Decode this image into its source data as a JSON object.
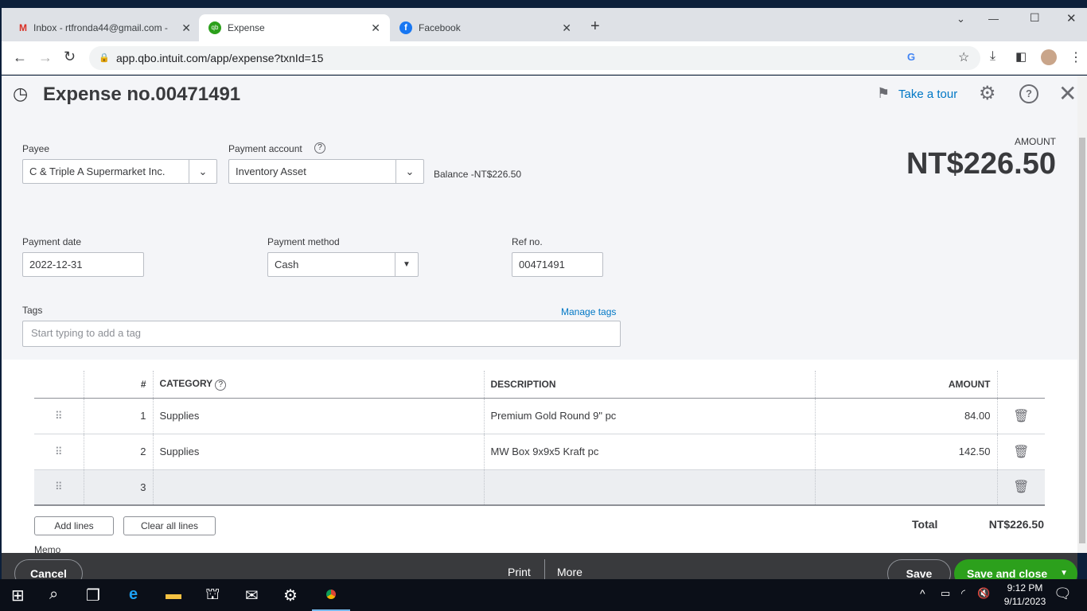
{
  "browser": {
    "tabs": [
      {
        "label": "Inbox - rtfronda44@gmail.com -"
      },
      {
        "label": "Expense"
      },
      {
        "label": "Facebook"
      }
    ],
    "url": "app.qbo.intuit.com/app/expense?txnId=15"
  },
  "header": {
    "title": "Expense no.00471491",
    "tour": "Take a tour"
  },
  "form": {
    "payee_label": "Payee",
    "payee": "C & Triple A Supermarket Inc.",
    "account_label": "Payment account",
    "account": "Inventory Asset",
    "balance": "Balance -NT$226.50",
    "amount_label": "AMOUNT",
    "amount": "NT$226.50",
    "date_label": "Payment date",
    "date": "2022-12-31",
    "method_label": "Payment method",
    "method": "Cash",
    "ref_label": "Ref no.",
    "ref": "00471491",
    "tags_label": "Tags",
    "manage_tags": "Manage tags",
    "tags_placeholder": "Start typing to add a tag"
  },
  "table": {
    "headers": [
      "#",
      "CATEGORY",
      "DESCRIPTION",
      "AMOUNT"
    ],
    "rows": [
      {
        "n": "1",
        "category": "Supplies",
        "description": "Premium Gold Round 9\" pc",
        "amount": "84.00"
      },
      {
        "n": "2",
        "category": "Supplies",
        "description": "MW Box 9x9x5 Kraft pc",
        "amount": "142.50"
      },
      {
        "n": "3",
        "category": "",
        "description": "",
        "amount": ""
      }
    ],
    "add_lines": "Add lines",
    "clear_lines": "Clear all lines",
    "total_label": "Total",
    "total": "NT$226.50",
    "memo_label": "Memo"
  },
  "footer": {
    "cancel": "Cancel",
    "print": "Print",
    "more": "More",
    "save": "Save",
    "save_close": "Save and close"
  },
  "taskbar": {
    "time": "9:12 PM",
    "date": "9/11/2023"
  }
}
